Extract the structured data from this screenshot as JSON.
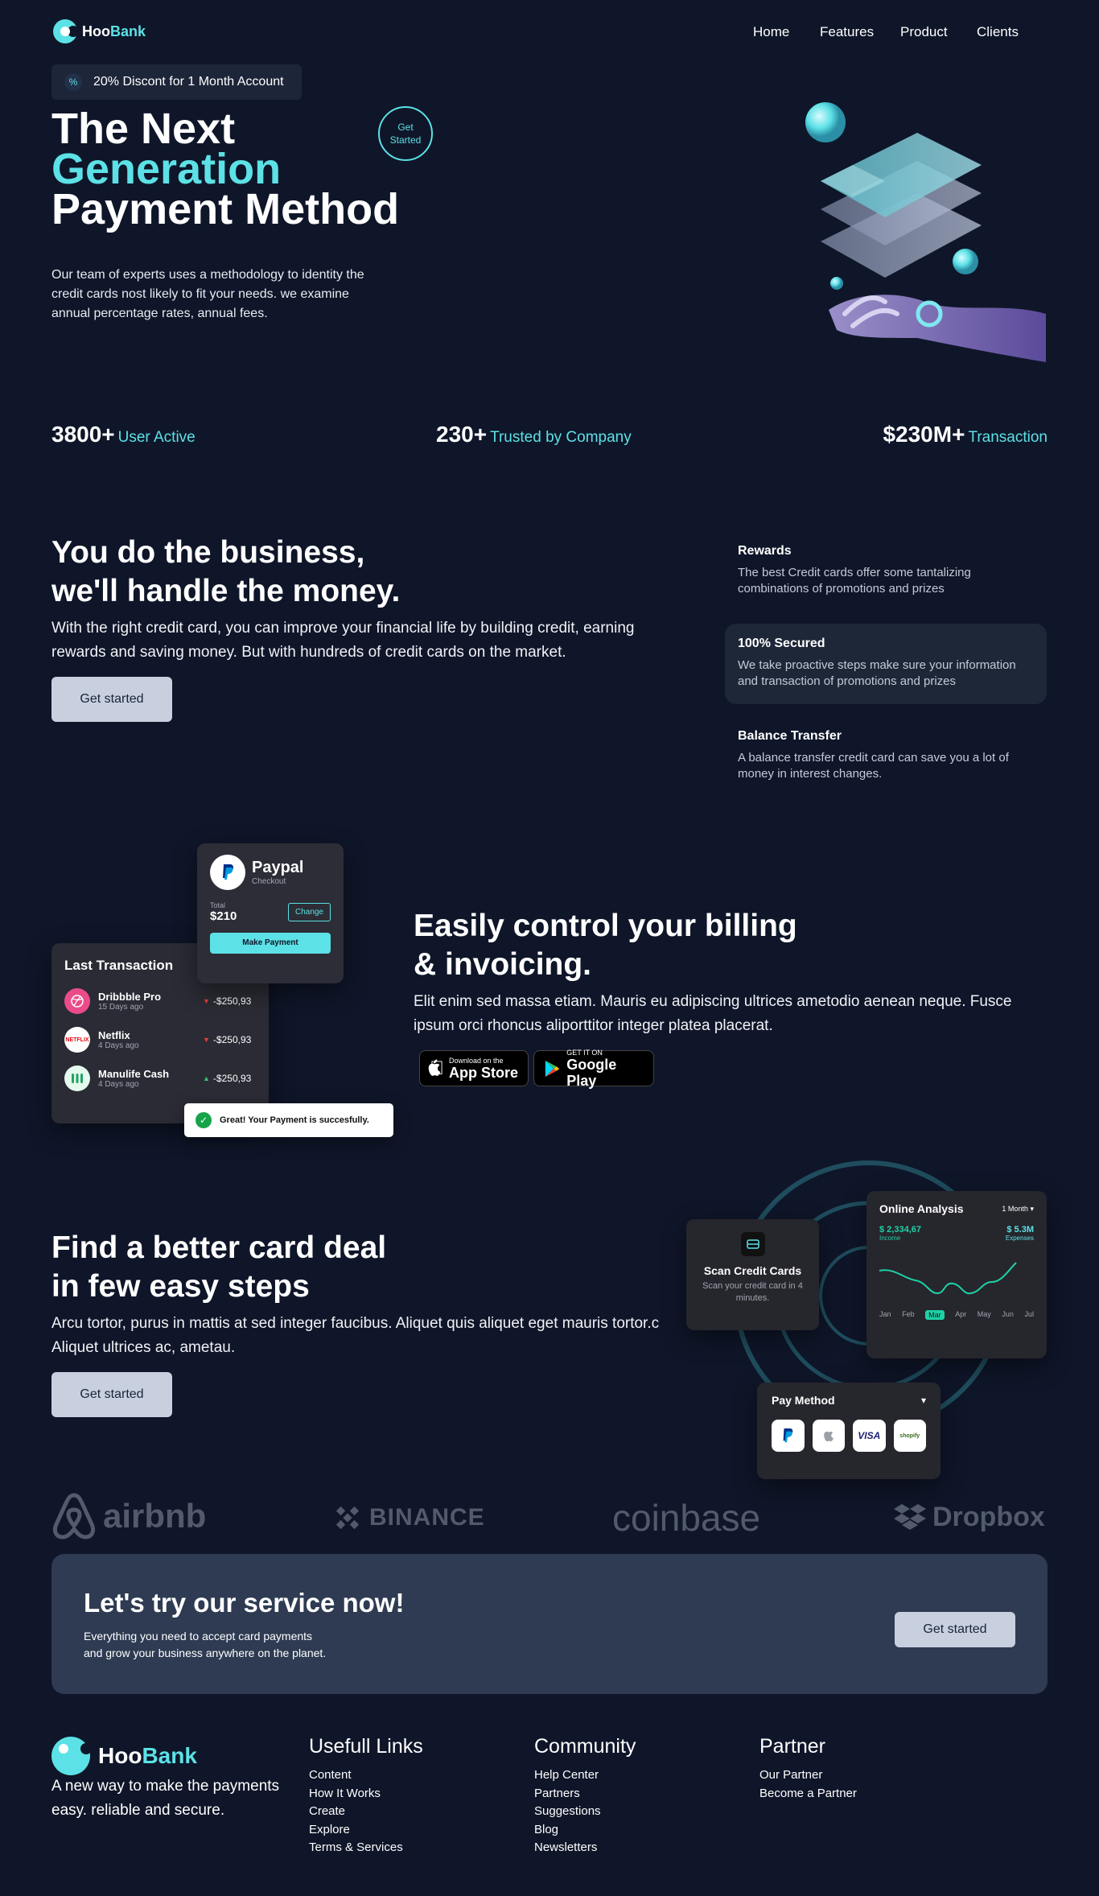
{
  "nav": {
    "brand_a": "Hoo",
    "brand_b": "Bank",
    "links": [
      "Home",
      "Features",
      "Product",
      "Clients"
    ]
  },
  "hero": {
    "discount_icon": "%",
    "discount_text": "20% Discont for 1 Month Account",
    "line1": "The Next",
    "line2": "Generation",
    "line3": "Payment Method",
    "cta_line1": "Get",
    "cta_line2": "Started",
    "desc": "Our team of experts uses a methodology to identity the credit cards nost likely to fit your needs. we examine annual percentage rates, annual fees."
  },
  "stats": [
    {
      "value": "3800+",
      "label": "User Active"
    },
    {
      "value": "230+",
      "label": "Trusted by Company"
    },
    {
      "value": "$230M+",
      "label": "Transaction"
    }
  ],
  "business": {
    "title_l1": "You do the business,",
    "title_l2": "we'll handle the money.",
    "desc": "With the right credit card, you can improve your financial life by building credit, earning rewards and saving money. But with hundreds of credit cards on the market.",
    "button": "Get started",
    "features": [
      {
        "title": "Rewards",
        "text": "The best Credit cards offer some tantalizing combinations of promotions and prizes"
      },
      {
        "title": "100% Secured",
        "text": "We take proactive steps make sure your information and transaction of promotions and prizes"
      },
      {
        "title": "Balance Transfer",
        "text": "A balance transfer credit card can save you a lot of money in interest changes."
      }
    ]
  },
  "billing": {
    "title_l1": "Easily control your billing",
    "title_l2": "& invoicing.",
    "desc": "Elit enim sed massa etiam. Mauris eu adipiscing ultrices ametodio aenean neque. Fusce ipsum orci rhoncus aliporttitor integer platea placerat.",
    "appstore_small": "Download on the",
    "appstore_big": "App Store",
    "google_small": "GET IT ON",
    "google_big": "Google Play",
    "paypal": {
      "name": "Paypal",
      "sub": "Checkout",
      "total_label": "Total",
      "total": "$210",
      "change": "Change",
      "make": "Make Payment"
    },
    "last_tx": {
      "title": "Last Transaction",
      "rows": [
        {
          "name": "Dribbble Pro",
          "sub": "15 Days ago",
          "amount": "-$250,93",
          "icon": "dribbble-icon",
          "color": "#ea4c89"
        },
        {
          "name": "Netflix",
          "sub": "4 Days ago",
          "amount": "-$250,93",
          "icon": "netflix-icon",
          "color": "#ffffff"
        },
        {
          "name": "Manulife Cash",
          "sub": "4 Days ago",
          "amount": "-$250,93",
          "icon": "manulife-icon",
          "color": "#e5f9ee"
        }
      ],
      "netflix_text": "NETFLIX"
    },
    "toast": "Great! Your Payment is succesfully."
  },
  "deal": {
    "title_l1": "Find a better card deal",
    "title_l2": "in few easy steps",
    "desc": "Arcu tortor, purus in mattis at sed integer faucibus. Aliquet quis aliquet eget mauris tortor.c Aliquet ultrices ac, ametau.",
    "button": "Get started",
    "scan": {
      "title": "Scan Credit Cards",
      "text": "Scan your credit card in 4 minutes."
    },
    "analysis": {
      "title": "Online Analysis",
      "period": "1 Month",
      "income": "$ 2,334,67",
      "income_label": "Income",
      "expense": "$ 5.3M",
      "expense_label": "Expenses",
      "months": [
        "Jan",
        "Feb",
        "Mar",
        "Apr",
        "May",
        "Jun",
        "Jul"
      ],
      "active_month": "Mar"
    },
    "pay": {
      "title": "Pay Method",
      "visa": "VISA",
      "shopify": "shopify"
    }
  },
  "brands": [
    "airbnb",
    "BINANCE",
    "coinbase",
    "Dropbox"
  ],
  "cta": {
    "title": "Let's try our service now!",
    "l1": "Everything you need to accept card payments",
    "l2": "and grow your business anywhere on the planet.",
    "button": "Get started"
  },
  "footer": {
    "brand_a": "Hoo",
    "brand_b": "Bank",
    "tagline_l1": "A new way to make the payments",
    "tagline_l2": "easy. reliable and secure.",
    "cols": [
      {
        "head": "Usefull Links",
        "links": [
          "Content",
          "How It Works",
          "Create",
          "Explore",
          "Terms & Services"
        ]
      },
      {
        "head": "Community",
        "links": [
          "Help Center",
          "Partners",
          "Suggestions",
          "Blog",
          "Newsletters"
        ]
      },
      {
        "head": "Partner",
        "links": [
          "Our Partner",
          "Become a Partner"
        ]
      }
    ]
  },
  "colors": {
    "bg": "#0f1629",
    "accent": "#5ce1e6",
    "panel": "#1e2738",
    "cta": "#2e3b52"
  }
}
